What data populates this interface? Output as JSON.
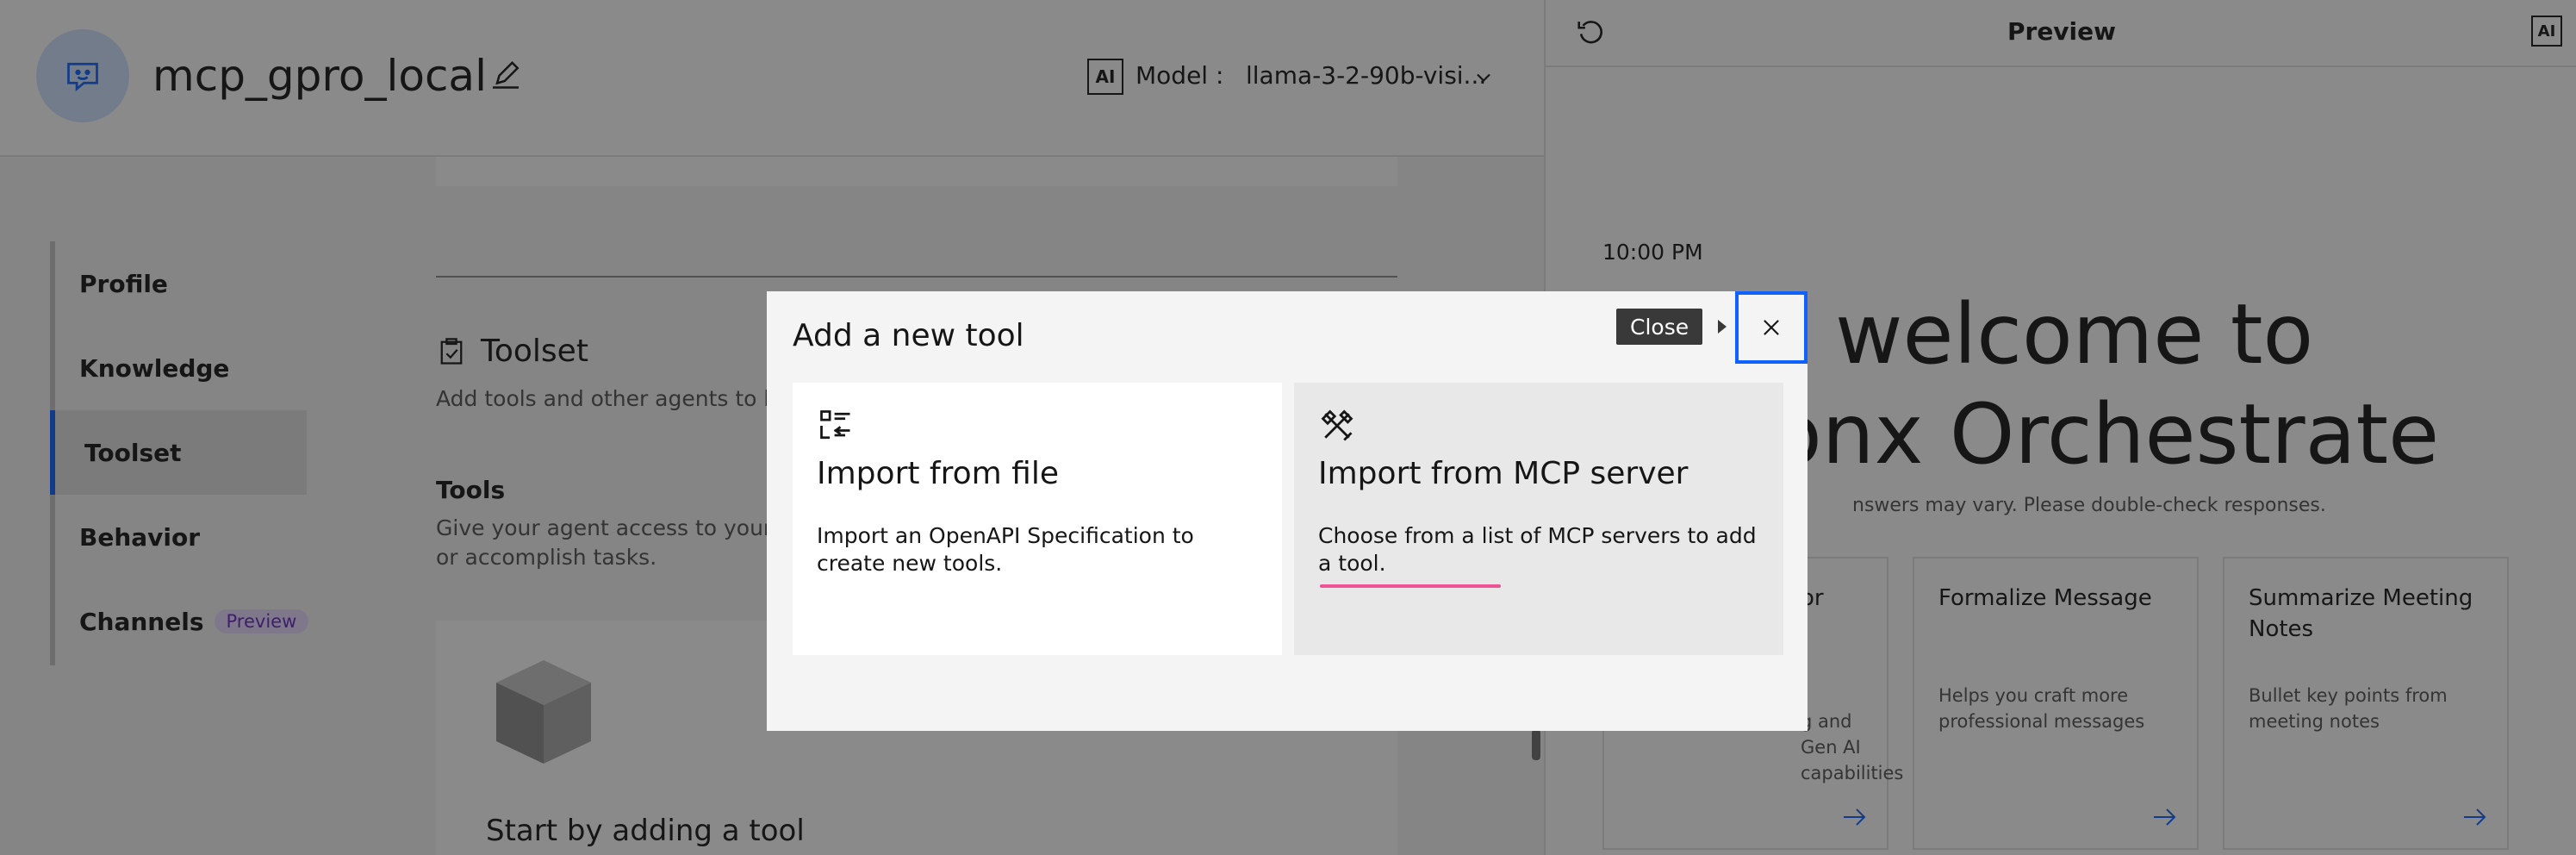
{
  "header": {
    "agent_name": "mcp_gpro_local",
    "ai_badge": "AI",
    "model_label": "Model :",
    "model_value": "llama-3-2-90b-visi..."
  },
  "sidenav": {
    "items": [
      {
        "label": "Profile"
      },
      {
        "label": "Knowledge"
      },
      {
        "label": "Toolset"
      },
      {
        "label": "Behavior"
      },
      {
        "label": "Channels",
        "tag": "Preview"
      }
    ],
    "active": "Toolset"
  },
  "toolset": {
    "title": "Toolset",
    "description": "Add tools and other agents to hel",
    "tools_title": "Tools",
    "tools_description": "Give your agent access to your or accomplish tasks.",
    "empty_title": "Start by adding a tool"
  },
  "preview": {
    "title": "Preview",
    "ai_badge": "AI",
    "time": "10:00 PM",
    "welcome": "welcome to\nonx Orchestrate",
    "disclaimer": "nswers may vary. Please double-check responses.",
    "cards": [
      {
        "title": "or",
        "description": "g and Gen AI capabilities"
      },
      {
        "title": "Formalize Message",
        "description": "Helps you craft more professional messages"
      },
      {
        "title": "Summarize Meeting Notes",
        "description": "Bullet key points from meeting notes"
      }
    ]
  },
  "modal": {
    "title": "Add a new tool",
    "close_tooltip": "Close",
    "options": [
      {
        "title": "Import from file",
        "description": "Import an OpenAPI Specification to create new tools.",
        "icon": "import-file-icon"
      },
      {
        "title": "Import from MCP server",
        "description": "Choose from a list of MCP servers to add a tool.",
        "icon": "tools-icon"
      }
    ]
  },
  "colors": {
    "accent": "#0f62fe",
    "hover_underline": "#ee5396",
    "tag_text": "#6929c4",
    "tag_bg": "#e8daff"
  }
}
